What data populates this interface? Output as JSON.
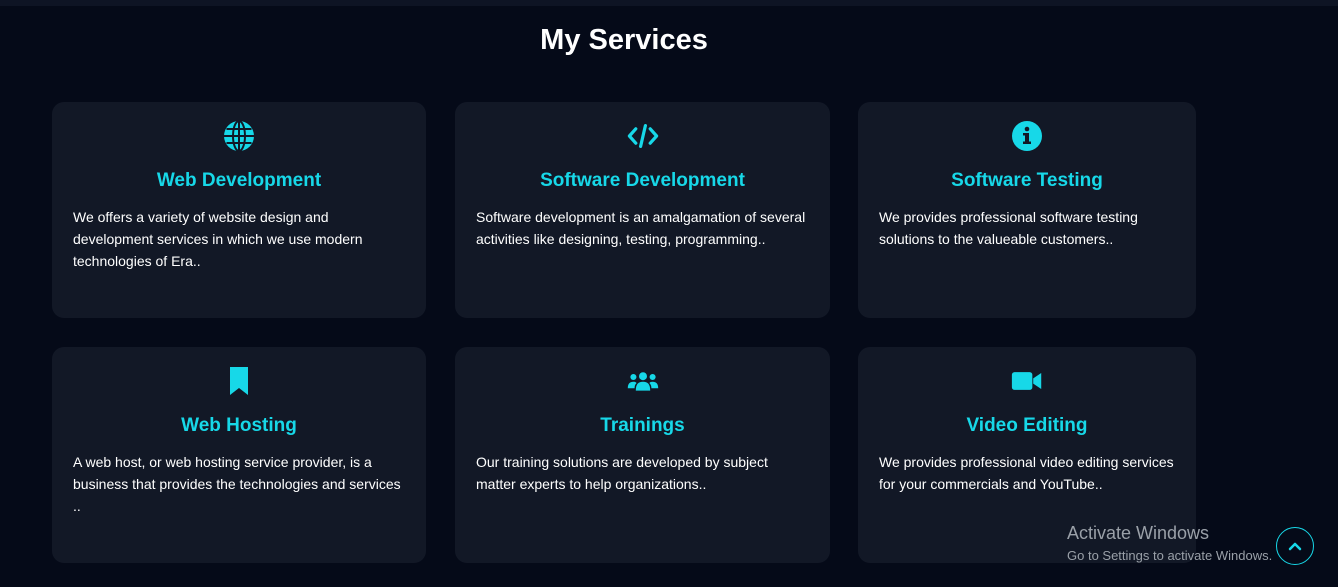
{
  "section": {
    "title": "My Services"
  },
  "colors": {
    "background": "#050a18",
    "card_background": "#121826",
    "accent": "#17d8e8",
    "text": "#ffffff"
  },
  "services": [
    {
      "icon": "globe-icon",
      "title": "Web Development",
      "description": "We offers a variety of website design and development services in which we use modern technologies of Era.."
    },
    {
      "icon": "code-icon",
      "title": "Software Development",
      "description": "Software development is an amalgamation of several activities like designing, testing, programming.."
    },
    {
      "icon": "info-circle-icon",
      "title": "Software Testing",
      "description": "We provides professional software testing solutions to the valueable customers.."
    },
    {
      "icon": "bookmark-icon",
      "title": "Web Hosting",
      "description": "A web host, or web hosting service provider, is a business that provides the technologies and services .."
    },
    {
      "icon": "users-icon",
      "title": "Trainings",
      "description": "Our training solutions are developed by subject matter experts to help organizations.."
    },
    {
      "icon": "video-camera-icon",
      "title": "Video Editing",
      "description": "We provides professional video editing services for your commercials and YouTube.."
    }
  ],
  "watermark": {
    "title": "Activate Windows",
    "subtitle": "Go to Settings to activate Windows."
  },
  "scroll_top": {
    "icon": "chevron-up-icon"
  }
}
